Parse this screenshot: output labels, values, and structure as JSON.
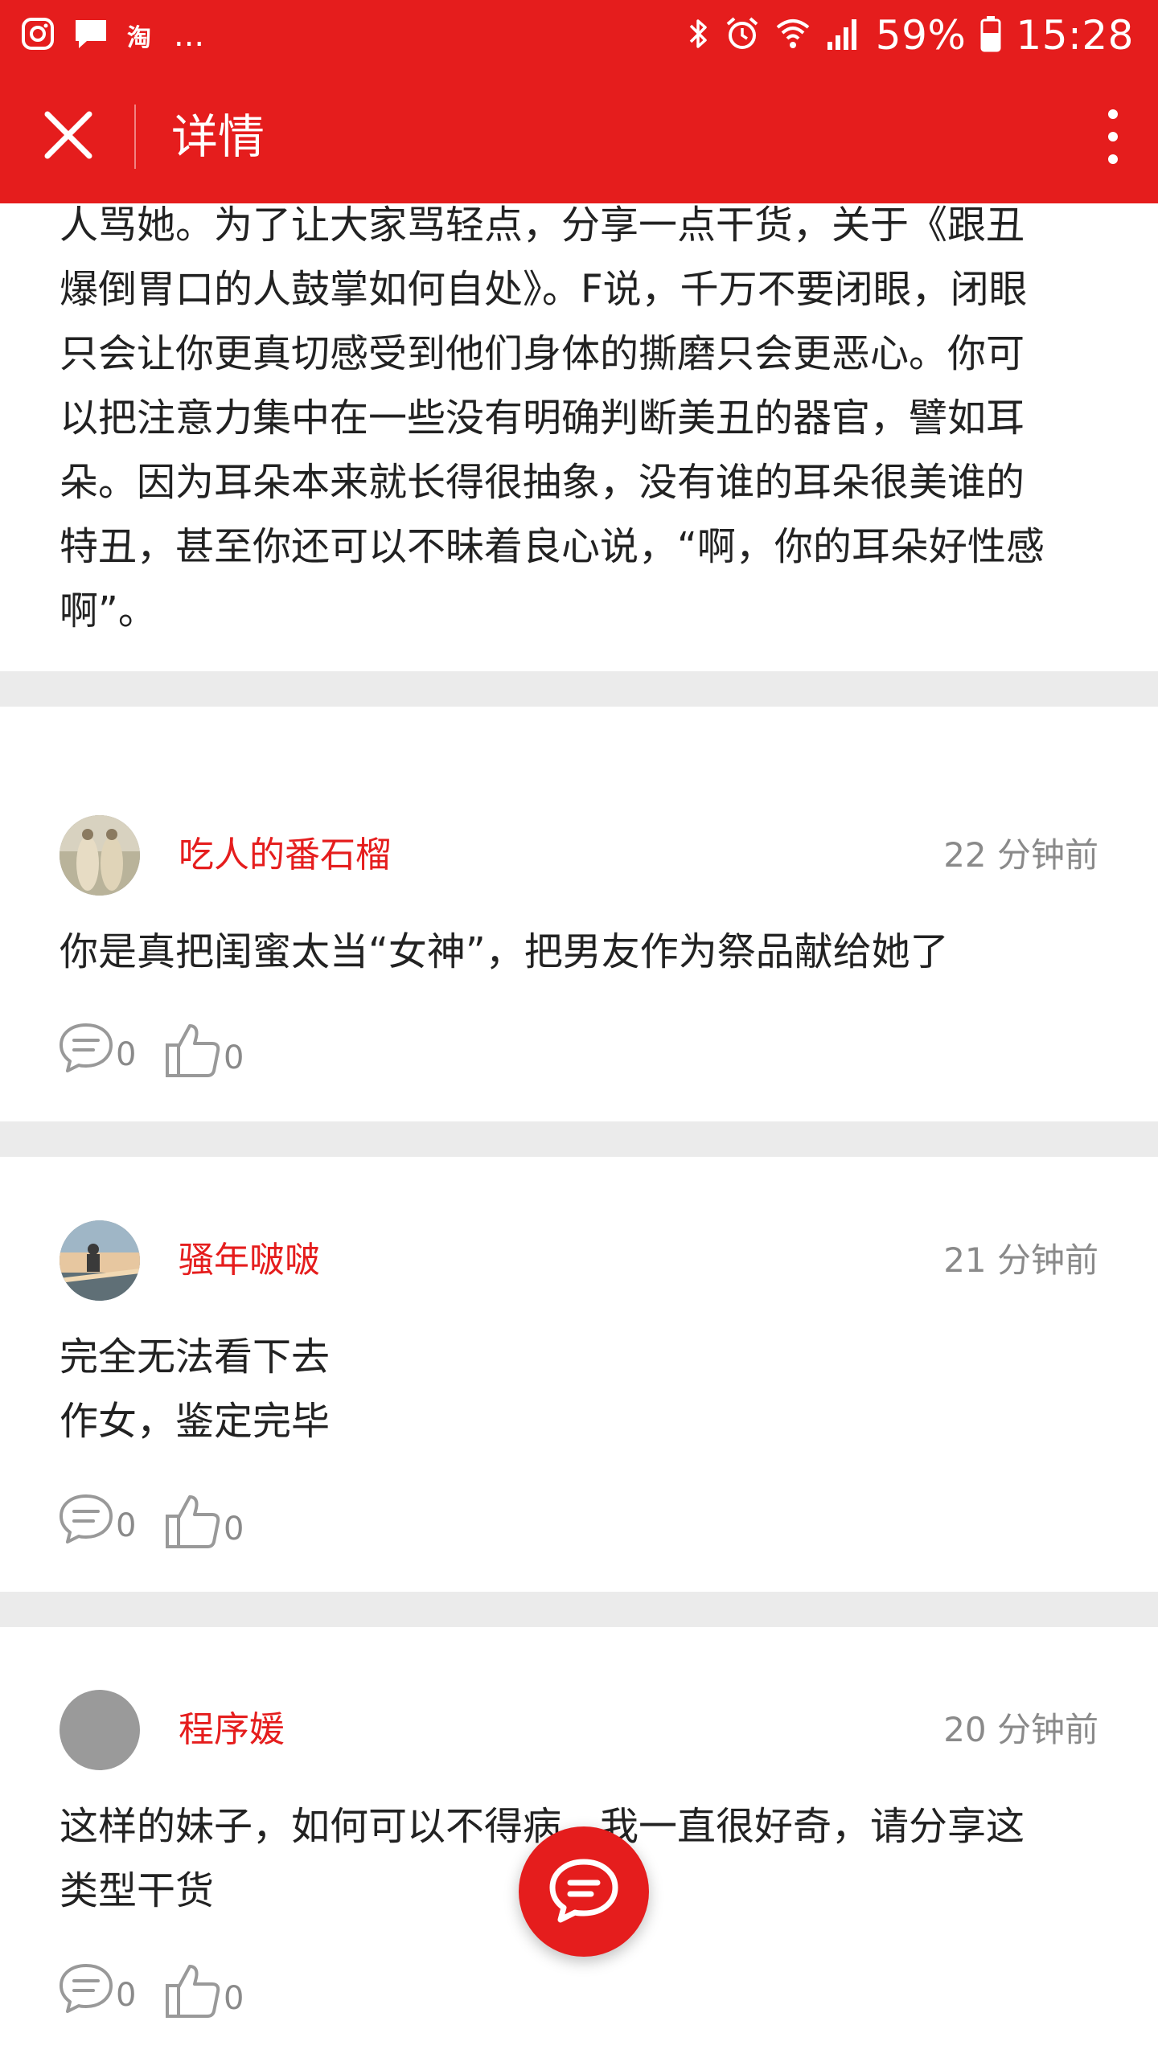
{
  "status_bar": {
    "left_icons": [
      "instagram-icon",
      "message-icon",
      "taobao-icon"
    ],
    "taobao_label": "淘",
    "more_label": "...",
    "right_icons": [
      "bluetooth-icon",
      "alarm-icon",
      "wifi-icon",
      "signal-icon",
      "battery-icon"
    ],
    "battery": "59%",
    "time": "15:28"
  },
  "app_bar": {
    "title": "详情",
    "close_icon": "close-icon",
    "more_icon": "more-vertical-icon",
    "background": "#e51d1d"
  },
  "article": {
    "lines": [
      "人骂她。为了让大家骂轻点，分享一点干货，关于《跟丑",
      "爆倒胃口的人鼓掌如何自处》。F说，千万不要闭眼，闭眼",
      "只会让你更真切感受到他们身体的撕磨只会更恶心。你可",
      "以把注意力集中在一些没有明确判断美丑的器官，譬如耳",
      "朵。因为耳朵本来就长得很抽象，没有谁的耳朵很美谁的",
      "特丑，甚至你还可以不昧着良心说，“啊，你的耳朵好性感",
      "啊”。"
    ]
  },
  "comments": [
    {
      "user": "吃人的番石榴",
      "time": "22 分钟前",
      "lines": [
        "你是真把闺蜜太当“女神”，把男友作为祭品献给她了"
      ],
      "reply_count": "0",
      "like_count": "0"
    },
    {
      "user": "骚年啵啵",
      "time": "21 分钟前",
      "lines": [
        "完全无法看下去",
        "作女，鉴定完毕"
      ],
      "reply_count": "0",
      "like_count": "0"
    },
    {
      "user": "程序媛",
      "time": "20 分钟前",
      "lines": [
        "这样的妹子，如何可以不得病。我一直很好奇，请分享这",
        "类型干货"
      ],
      "reply_count": "0",
      "like_count": "0"
    }
  ],
  "fab": {
    "icon": "comment-icon"
  },
  "colors": {
    "accent": "#e51d1d",
    "muted": "#8a8a8a",
    "separator": "#ebebeb"
  }
}
